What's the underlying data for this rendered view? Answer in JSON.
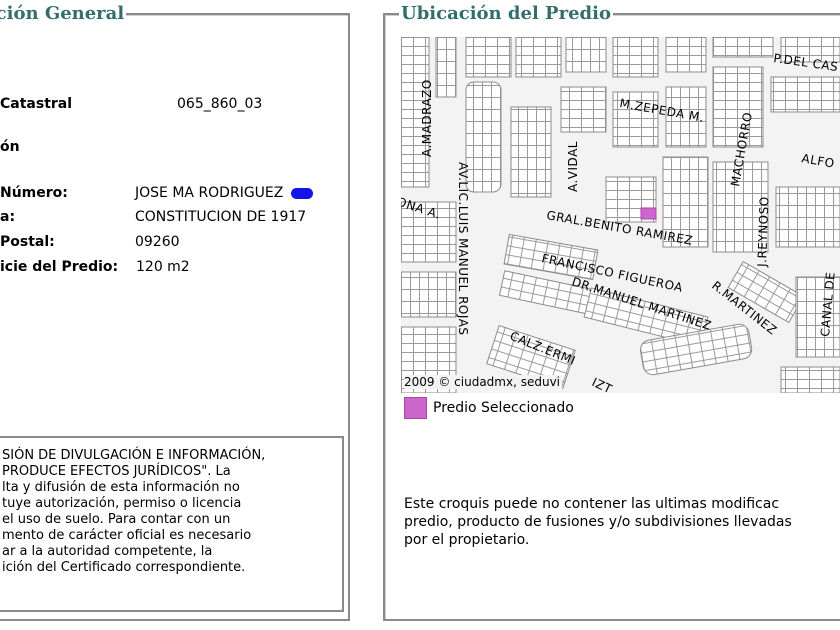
{
  "left_panel": {
    "legend": "ación General",
    "rows": [
      {
        "label": " Catastral",
        "value": "065_860_03"
      },
      {
        "label": "ón",
        "value": ""
      },
      {
        "label": " Número:",
        "value": "JOSE MA RODRIGUEZ"
      },
      {
        "label": "a:",
        "value": "CONSTITUCION DE 1917"
      },
      {
        "label": " Postal:",
        "value": "09260"
      },
      {
        "label": "icie del Predio:",
        "value": "120 m2"
      }
    ],
    "notice_lines": [
      "SIÓN DE DIVULGACIÓN E INFORMACIÓN,",
      "PRODUCE EFECTOS JURÍDICOS\". La",
      "lta y difusión de esta información no",
      "tuye autorización, permiso o licencia",
      "el uso de suelo. Para contar con un",
      "mento de carácter oficial es necesario",
      "ar a la autoridad competente, la",
      "ición del Certificado correspondiente."
    ]
  },
  "right_panel": {
    "legend": "Ubicación del Predio",
    "credit": "2009 © ciudadmx, seduvi",
    "legend_label": "Predio Seleccionado",
    "legend_color": "#cc66cc",
    "note_lines": [
      "Este croquis puede no contener las ultimas modificac",
      "predio, producto de fusiones y/o subdivisiones llevadas",
      "por el propietario."
    ]
  },
  "map_labels": {
    "p_del_cas": "P.DEL CAS",
    "zepeda": "M.ZEPEDA M.",
    "alfo": "ALFO",
    "madrazo": "A.MADRAZO",
    "vidal": "A.VIDAL",
    "machorro": "MACHORRO",
    "reynoso": "J.REYNOSO",
    "av_lic": "AV.LIC.LUIS MANUEL ROJAS",
    "ona": "ONA A.",
    "benito": "GRAL.BENITO RAMIREZ",
    "figueroa": "FRANCISCO FIGUEROA",
    "martinez_r": "R.MARTINEZ",
    "manuel_martinez": "DR.MANUEL MARTINEZ",
    "calz": "CALZ.ERMI",
    "canal": "CANAL DE",
    "izt": "IZT"
  }
}
